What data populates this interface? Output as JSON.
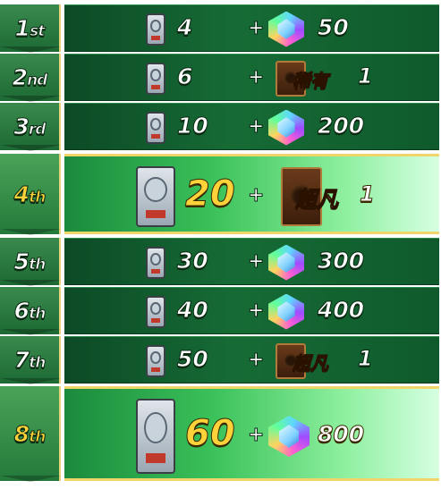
{
  "ranks": [
    {
      "num": "1",
      "suffix": "st",
      "big": false
    },
    {
      "num": "2",
      "suffix": "nd",
      "big": false
    },
    {
      "num": "3",
      "suffix": "rd",
      "big": false
    },
    {
      "num": "4",
      "suffix": "th",
      "big": true
    },
    {
      "num": "5",
      "suffix": "th",
      "big": false
    },
    {
      "num": "6",
      "suffix": "th",
      "big": false
    },
    {
      "num": "7",
      "suffix": "th",
      "big": false
    },
    {
      "num": "8",
      "suffix": "th",
      "big": true
    }
  ],
  "rewards": [
    {
      "packs": "4",
      "plus": "+",
      "type": "gem",
      "amount": "50"
    },
    {
      "packs": "6",
      "plus": "+",
      "type": "ticket",
      "ticket_label": "稀有",
      "amount": "1"
    },
    {
      "packs": "10",
      "plus": "+",
      "type": "gem",
      "amount": "200"
    },
    {
      "packs": "20",
      "plus": "+",
      "type": "ticket",
      "ticket_label": "超凡",
      "amount": "1"
    },
    {
      "packs": "30",
      "plus": "+",
      "type": "gem",
      "amount": "300"
    },
    {
      "packs": "40",
      "plus": "+",
      "type": "gem",
      "amount": "400"
    },
    {
      "packs": "50",
      "plus": "+",
      "type": "ticket",
      "ticket_label": "超凡",
      "amount": "1"
    },
    {
      "packs": "60",
      "plus": "+",
      "type": "gem",
      "amount": "800"
    }
  ],
  "icons": {
    "pack": "card-pack-icon",
    "gem": "gem-icon",
    "ticket": "rarity-ticket-icon"
  }
}
